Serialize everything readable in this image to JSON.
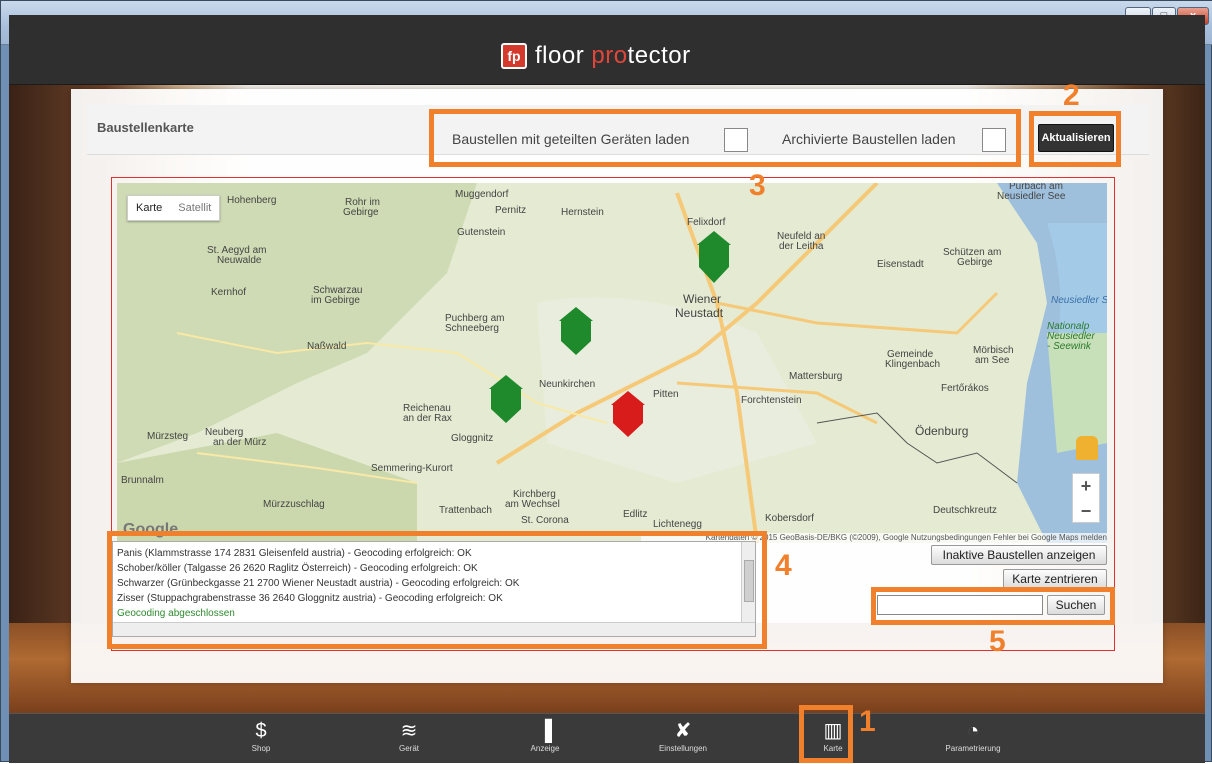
{
  "window": {
    "minimize": "–",
    "maximize": "□",
    "close": "x"
  },
  "app": {
    "logo_prefix": "floor ",
    "logo_pro": "pro",
    "logo_suffix": "tector",
    "logo_mark": "fp"
  },
  "panel": {
    "title": "Baustellenkarte",
    "shared_label": "Baustellen mit geteilten Geräten laden",
    "archived_label": "Archivierte Baustellen laden",
    "refresh_label": "Aktualisieren"
  },
  "map": {
    "type_karte": "Karte",
    "type_satellit": "Satellit",
    "zoom_in": "+",
    "zoom_out": "−",
    "google": "Google",
    "attribution": "Kartendaten © 2015 GeoBasis-DE/BKG (©2009), Google   Nutzungsbedingungen   Fehler bei Google Maps melden",
    "places": [
      "Hohenberg",
      "Rohr im Gebirge",
      "Muggendorf",
      "Pernitz",
      "Hernstein",
      "Felixdorf",
      "Neufeld an der Leitha",
      "Purbach am Neusiedler See",
      "St. Aegyd am Neuwalde",
      "Gutenstein",
      "Eisenstadt",
      "Schützen am Gebirge",
      "Kernhof",
      "Schwarzau im Gebirge",
      "Puchberg am Schneeberg",
      "Wiener Neustadt",
      "Naßwald",
      "Gemeinde Klingenbach",
      "Mörbisch am See",
      "Mattersburg",
      "Neunkirchen",
      "Pitten",
      "Forchtenstein",
      "Fertőrákos",
      "Reichenau an der Rax",
      "Gloggnitz",
      "Mürzsteg",
      "Neuberg an der Mürz",
      "Ödenburg",
      "Semmering-Kurort",
      "Brunnalm",
      "Mürzzuschlag",
      "Kirchberg am Wechsel",
      "Trattenbach",
      "St. Corona",
      "Edlitz",
      "Lichtenegg",
      "Kobersdorf",
      "Deutschkreutz",
      "Neusiedler See",
      "Nationalp Neusiedler - Seewink"
    ]
  },
  "log": {
    "lines": [
      "Panis (Klammstrasse 174 2831 Gleisenfeld austria) - Geocoding erfolgreich: OK",
      "Schober/köller (Talgasse 26 2620 Raglitz Österreich) - Geocoding erfolgreich: OK",
      "Schwarzer (Grünbeckgasse 21 2700 Wiener Neustadt austria) - Geocoding erfolgreich: OK",
      "Zisser (Stuppachgrabenstrasse 36 2640 Gloggnitz austria) - Geocoding erfolgreich: OK"
    ],
    "done": "Geocoding abgeschlossen"
  },
  "buttons": {
    "inactive": "Inaktive Baustellen anzeigen",
    "center": "Karte zentrieren",
    "search": "Suchen"
  },
  "search": {
    "value": ""
  },
  "callouts": {
    "c1": "1",
    "c2": "2",
    "c3": "3",
    "c4": "4",
    "c5": "5"
  },
  "nav": [
    {
      "label": "Shop",
      "icon": "dollar-icon"
    },
    {
      "label": "Gerät",
      "icon": "layers-icon"
    },
    {
      "label": "Anzeige",
      "icon": "bar-chart-icon"
    },
    {
      "label": "Einstellungen",
      "icon": "tools-icon"
    },
    {
      "label": "Karte",
      "icon": "map-icon"
    },
    {
      "label": "Parametrierung",
      "icon": "gauge-icon"
    }
  ],
  "colors": {
    "accent_orange": "#f0802c",
    "marker_green": "#1f8a2c",
    "marker_red": "#d81c1c",
    "frame_red": "#e03030"
  }
}
